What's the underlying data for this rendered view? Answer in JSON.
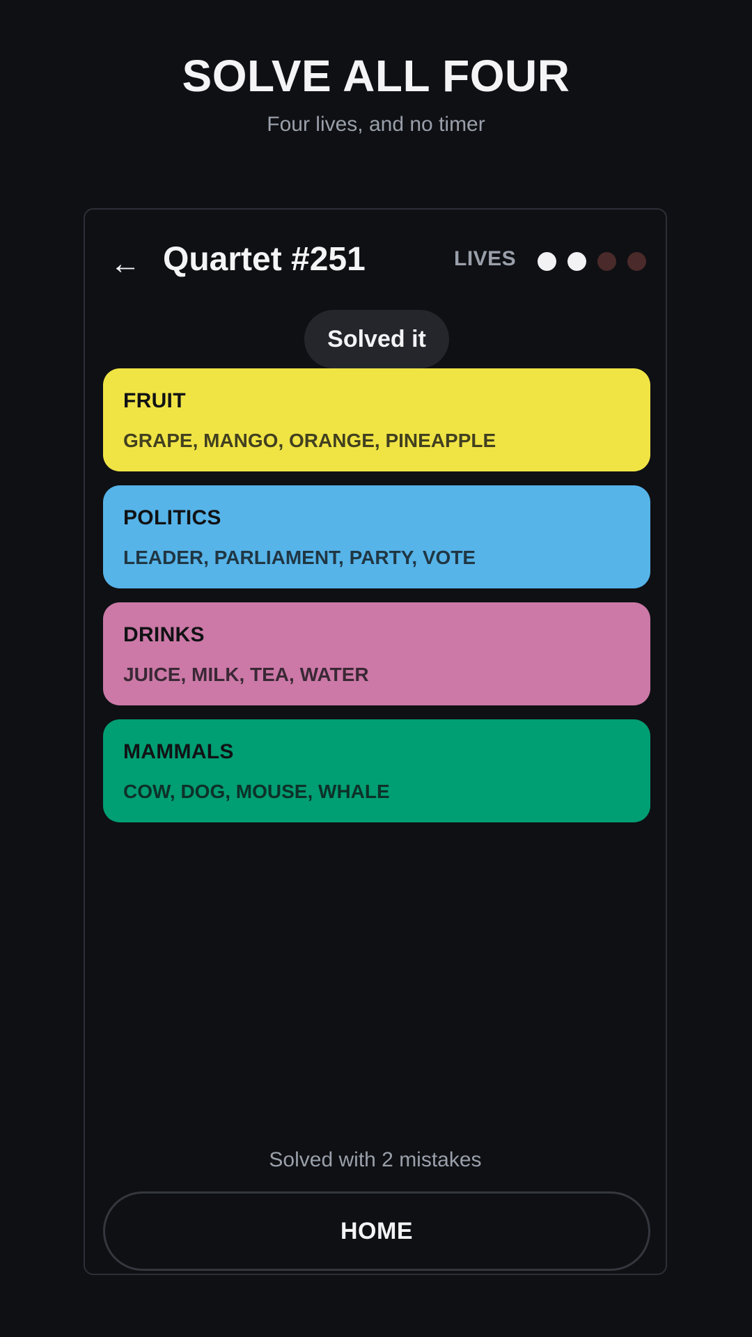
{
  "page": {
    "title": "SOLVE ALL FOUR",
    "subtitle": "Four lives, and no timer"
  },
  "header": {
    "back_icon": "←",
    "puzzle_title": "Quartet #251",
    "lives_label": "LIVES",
    "lives_total": 4,
    "lives_remaining": 2,
    "life_active_color": "#f2f2f5",
    "life_lost_color": "#4a2a2a"
  },
  "toast": {
    "label": "Solved it"
  },
  "groups": [
    {
      "name": "FRUIT",
      "words": "GRAPE, MANGO, ORANGE, PINEAPPLE",
      "color": "#f0e445"
    },
    {
      "name": "POLITICS",
      "words": "LEADER, PARLIAMENT, PARTY, VOTE",
      "color": "#56b4e9"
    },
    {
      "name": "DRINKS",
      "words": "JUICE, MILK, TEA, WATER",
      "color": "#cc79a7"
    },
    {
      "name": "MAMMALS",
      "words": "COW, DOG, MOUSE, WHALE",
      "color": "#009e73"
    }
  ],
  "result": {
    "text": "Solved with 2 mistakes"
  },
  "home_button": {
    "label": "HOME"
  }
}
